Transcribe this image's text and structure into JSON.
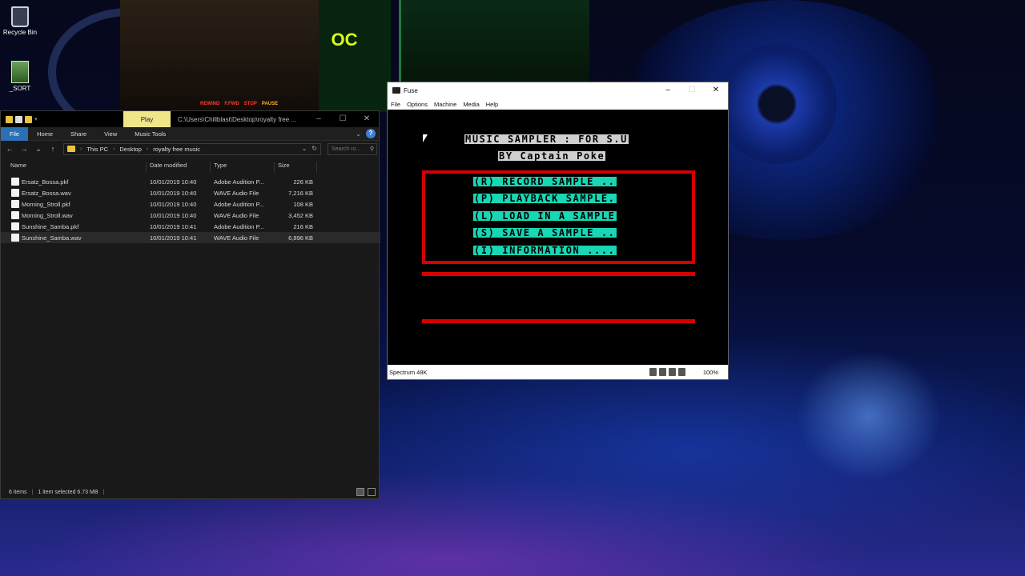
{
  "desktop": {
    "icons": [
      {
        "label": "Recycle Bin"
      },
      {
        "label": "_SORT"
      }
    ],
    "wallpaper_logo": "OC",
    "wallpaper_tape_buttons": [
      "REWIND",
      "F.FWD",
      "STOP",
      "PAUSE"
    ]
  },
  "explorer": {
    "play_tab": "Play",
    "title_path": "C:\\Users\\Chillblast\\Desktop\\royalty free ...",
    "ribbon_tabs": [
      "File",
      "Home",
      "Share",
      "View",
      "Music Tools"
    ],
    "breadcrumb": [
      "This PC",
      "Desktop",
      "royalty free music"
    ],
    "search_placeholder": "Search ro...",
    "columns": {
      "name": "Name",
      "date": "Date modified",
      "type": "Type",
      "size": "Size"
    },
    "files": [
      {
        "name": "Ersatz_Bossa.pkf",
        "date": "10/01/2019 10:40",
        "type": "Adobe Audition P...",
        "size": "226 KB"
      },
      {
        "name": "Ersatz_Bossa.wav",
        "date": "10/01/2019 10:40",
        "type": "WAVE Audio File",
        "size": "7,216 KB"
      },
      {
        "name": "Morning_Stroll.pkf",
        "date": "10/01/2019 10:40",
        "type": "Adobe Audition P...",
        "size": "108 KB"
      },
      {
        "name": "Morning_Stroll.wav",
        "date": "10/01/2019 10:40",
        "type": "WAVE Audio File",
        "size": "3,452 KB"
      },
      {
        "name": "Sunshine_Samba.pkf",
        "date": "10/01/2019 10:41",
        "type": "Adobe Audition P...",
        "size": "216 KB"
      },
      {
        "name": "Sunshine_Samba.wav",
        "date": "10/01/2019 10:41",
        "type": "WAVE Audio File",
        "size": "6,896 KB"
      }
    ],
    "status_items": "6 items",
    "status_selected": "1 item selected  6.73 MB"
  },
  "fuse": {
    "title": "Fuse",
    "menu": [
      "File",
      "Options",
      "Machine",
      "Media",
      "Help"
    ],
    "screen": {
      "title_line1": "MUSIC SAMPLER : FOR S.U",
      "title_line2": "BY Captain Poke",
      "menu_items": [
        "(R) RECORD SAMPLE ..",
        "(P) PLAYBACK SAMPLE.",
        "(L) LOAD IN A SAMPLE",
        "(S) SAVE A SAMPLE ..",
        "(I) INFORMATION ...."
      ]
    },
    "status_model": "Spectrum 48K",
    "status_zoom": "100%"
  }
}
